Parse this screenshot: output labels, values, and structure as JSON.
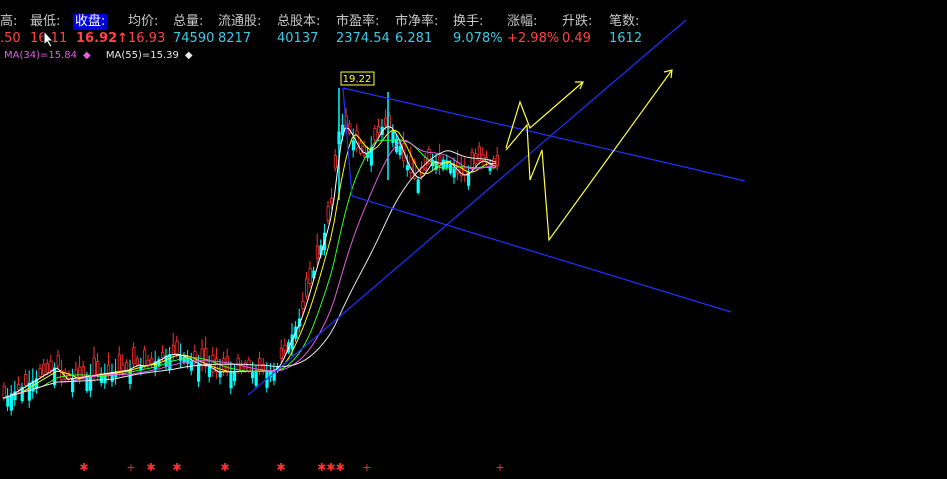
{
  "quote": {
    "items": [
      {
        "label": "高:",
        "value": ".50",
        "value_color": "#ff4444"
      },
      {
        "label": "最低:",
        "value": "16.11",
        "value_color": "#ff4444"
      },
      {
        "label": "收盘:",
        "value": "16.92↑",
        "value_color": "#ff4444",
        "selected": true
      },
      {
        "label": "均价:",
        "value": "16.93",
        "value_color": "#ff4444"
      },
      {
        "label": "总量:",
        "value": "74590",
        "value_color": "#3fc9e4"
      },
      {
        "label": "流通股:",
        "value": "8217",
        "value_color": "#3fc9e4"
      },
      {
        "label": "总股本:",
        "value": "40137",
        "value_color": "#3fc9e4"
      },
      {
        "label": "市盈率:",
        "value": "2374.54",
        "value_color": "#3fc9e4"
      },
      {
        "label": "市净率:",
        "value": "6.281",
        "value_color": "#3fc9e4"
      },
      {
        "label": "换手:",
        "value": "9.078%",
        "value_color": "#3fc9e4"
      },
      {
        "label": "涨幅:",
        "value": "+2.98%",
        "value_color": "#ff4444"
      },
      {
        "label": "升跌:",
        "value": "0.49",
        "value_color": "#ff4444"
      },
      {
        "label": "笔数:",
        "value": "1612",
        "value_color": "#3fc9e4"
      }
    ]
  },
  "ma_legend": [
    {
      "text": "MA(34)=15.84",
      "color": "#e060e0",
      "arrow": "◆"
    },
    {
      "text": "MA(55)=15.39",
      "color": "#e8e8e8",
      "arrow": "◆"
    }
  ],
  "chart": {
    "peak_label": "19.22",
    "colors": {
      "up": "#ff3030",
      "down": "#00ffff",
      "ma5": "#ffffff",
      "ma10": "#ffff00",
      "ma20": "#30ff30",
      "ma34": "#e060e0",
      "ma55": "#e8e8e8",
      "trend": "#1e32ff",
      "forecast": "#ffff40",
      "signal": "#ff3030"
    }
  },
  "signals": [
    "✱",
    "+",
    "✱",
    "✱",
    "✱",
    "✱",
    "✱✱✱",
    "+",
    "+"
  ]
}
